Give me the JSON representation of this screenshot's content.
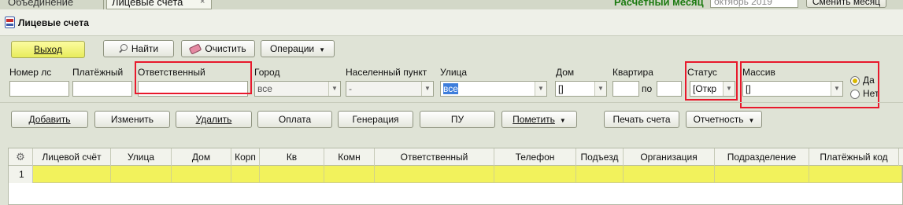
{
  "tabs": [
    {
      "label": "Объединение"
    },
    {
      "label": "Лицевые счета",
      "close": "×"
    }
  ],
  "header": {
    "period_label": "Расчетный месяц",
    "period_value": "октябрь 2019",
    "change_month_label": "Сменить месяц",
    "page_title": "Лицевые счета",
    "accent_color": "#1b7a10"
  },
  "toolbar": {
    "exit_label": "Выход",
    "find_label": "Найти",
    "clear_label": "Очистить",
    "operations_label": "Операции"
  },
  "filters": {
    "account_number": {
      "label": "Номер лс",
      "value": ""
    },
    "payer": {
      "label": "Платёжный",
      "value": ""
    },
    "responsible": {
      "label": "Ответственный",
      "value": ""
    },
    "city": {
      "label": "Город",
      "value": "все"
    },
    "settlement": {
      "label": "Населенный пункт",
      "value": "-"
    },
    "street": {
      "label": "Улица",
      "value": "все"
    },
    "house": {
      "label": "Дом",
      "value": "[]"
    },
    "apartment": {
      "label": "Квартира",
      "from": "",
      "to_label": "по",
      "to": ""
    },
    "status": {
      "label": "Статус",
      "value": "[Откр"
    },
    "massiv": {
      "label": "Массив",
      "value": "[]"
    },
    "radio": {
      "yes": "Да",
      "no": "Нет",
      "selected": "yes"
    }
  },
  "actions": {
    "add": "Добавить",
    "edit": "Изменить",
    "delete": "Удалить",
    "payment": "Оплата",
    "generation": "Генерация",
    "pu": "ПУ",
    "mark": "Пометить",
    "print": "Печать счета",
    "reports": "Отчетность"
  },
  "grid": {
    "columns": [
      "Лицевой счёт",
      "Улица",
      "Дом",
      "Корп",
      "Кв",
      "Комн",
      "Ответственный",
      "Телефон",
      "Подъезд",
      "Организация",
      "Подразделение",
      "Платёжный код"
    ],
    "rows": [
      {
        "num": "1"
      }
    ],
    "row_color": "#f2f25c"
  },
  "icons": {
    "logo": "app-logo-icon",
    "settings": "gear-icon",
    "find": "search-icon",
    "clear": "eraser-icon"
  }
}
